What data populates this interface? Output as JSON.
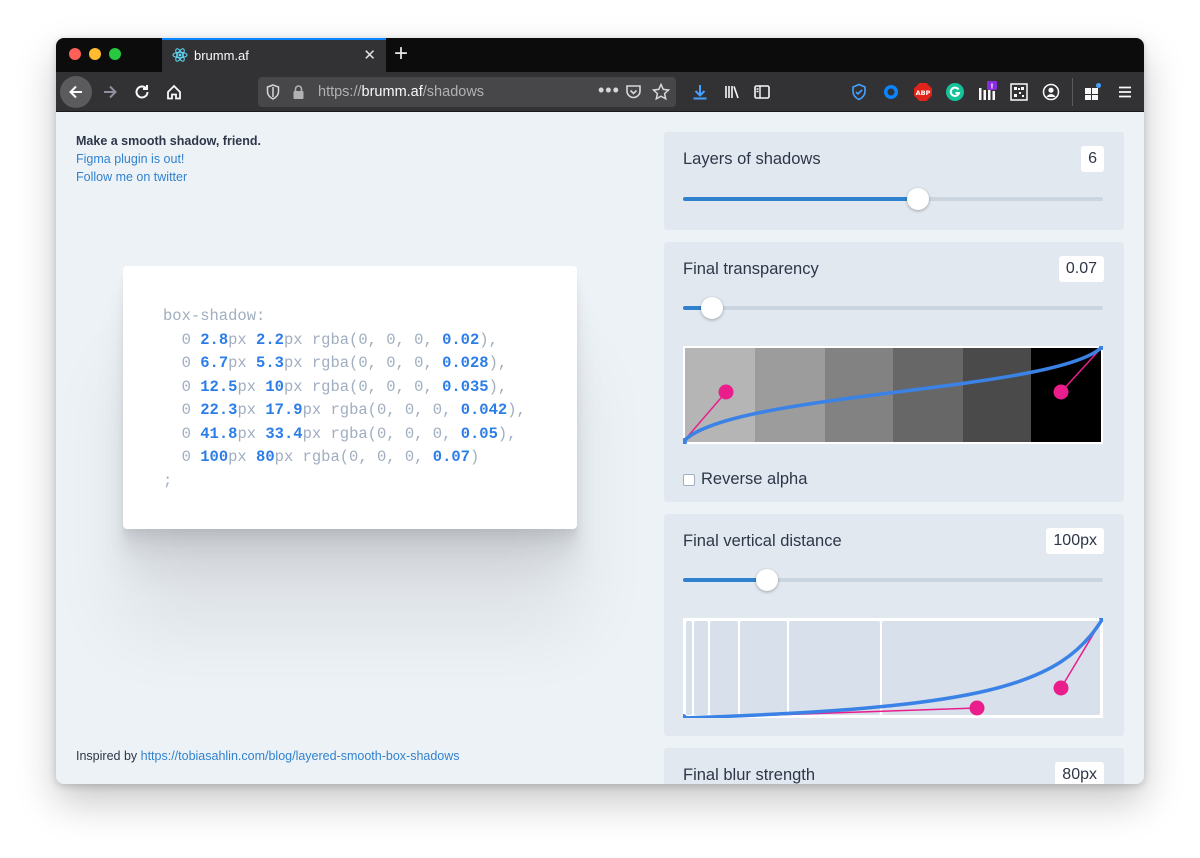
{
  "browser": {
    "tab_title": "brumm.af",
    "url_protocol": "https://",
    "url_host": "brumm.af",
    "url_path": "/shadows",
    "accent_color": "#0a84ff"
  },
  "intro": {
    "headline": "Make a smooth shadow, friend.",
    "link_figma": "Figma plugin is out!",
    "link_twitter": "Follow me on twitter"
  },
  "code": {
    "property": "box-shadow:",
    "lines": [
      {
        "y": "2.8",
        "blur": "2.2",
        "alpha": "0.02",
        "end": "),"
      },
      {
        "y": "6.7",
        "blur": "5.3",
        "alpha": "0.028",
        "end": "),"
      },
      {
        "y": "12.5",
        "blur": "10",
        "alpha": "0.035",
        "end": "),"
      },
      {
        "y": "22.3",
        "blur": "17.9",
        "alpha": "0.042",
        "end": "),"
      },
      {
        "y": "41.8",
        "blur": "33.4",
        "alpha": "0.05",
        "end": "),"
      },
      {
        "y": "100",
        "blur": "80",
        "alpha": "0.07",
        "end": ")"
      }
    ],
    "terminator": ";"
  },
  "credit": {
    "prefix": "Inspired by ",
    "link": "https://tobiasahlin.com/blog/layered-smooth-box-shadows"
  },
  "controls": {
    "layers": {
      "label": "Layers of shadows",
      "value": "6",
      "fraction": 0.56
    },
    "transparency": {
      "label": "Final transparency",
      "value": "0.07",
      "fraction": 0.07
    },
    "reverse_alpha": {
      "label": "Reverse alpha",
      "checked": false
    },
    "vertical_distance": {
      "label": "Final vertical distance",
      "value": "100px",
      "fraction": 0.2
    },
    "blur_strength": {
      "label": "Final blur strength",
      "value": "80px"
    }
  },
  "colors": {
    "slider_blue": "#3182ce",
    "curve_blue": "#3b82e6",
    "handle_pink": "#e91e8c",
    "link_blue": "#3182ce"
  }
}
